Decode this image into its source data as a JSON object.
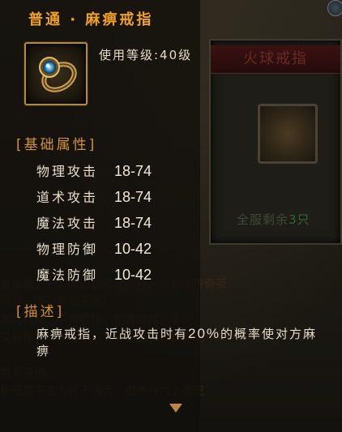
{
  "tooltip": {
    "title": "普通 · 麻痹戒指",
    "level_requirement": "使用等级:40级",
    "icon": "ring-icon",
    "basic_attributes": {
      "heading": "[基础属性]",
      "rows": [
        {
          "label": "物理攻击",
          "value": "18-74"
        },
        {
          "label": "道术攻击",
          "value": "18-74"
        },
        {
          "label": "魔法攻击",
          "value": "18-74"
        },
        {
          "label": "物理防御",
          "value": "10-42"
        },
        {
          "label": "魔法防御",
          "value": "10-42"
        }
      ]
    },
    "description": {
      "heading": "[描述]",
      "text_before": "麻痹戒指，近战攻击时有",
      "percent": "20%",
      "text_after": "的概率使对方麻痹"
    }
  },
  "background_card": {
    "title": "火球戒指",
    "remaining_label": "全服剩余",
    "remaining_count": "3只"
  },
  "background_lore": [
    "麻戒指，它们有的被魔物所得，有的被传奇英",
    "得其一便可撼动天地！",
    "复活戒指、麻痹戒指、护身戒指、吸",
    "又被称为传奇戒指，又通常上已经销售无",
    "",
    "机率获得。",
    "秘密宝下去力并不强大，但传作为上等记"
  ],
  "colors": {
    "title": "#f0a21e",
    "section": "#d2922e",
    "text": "#e6dccb",
    "frame": "#b08a3e"
  }
}
